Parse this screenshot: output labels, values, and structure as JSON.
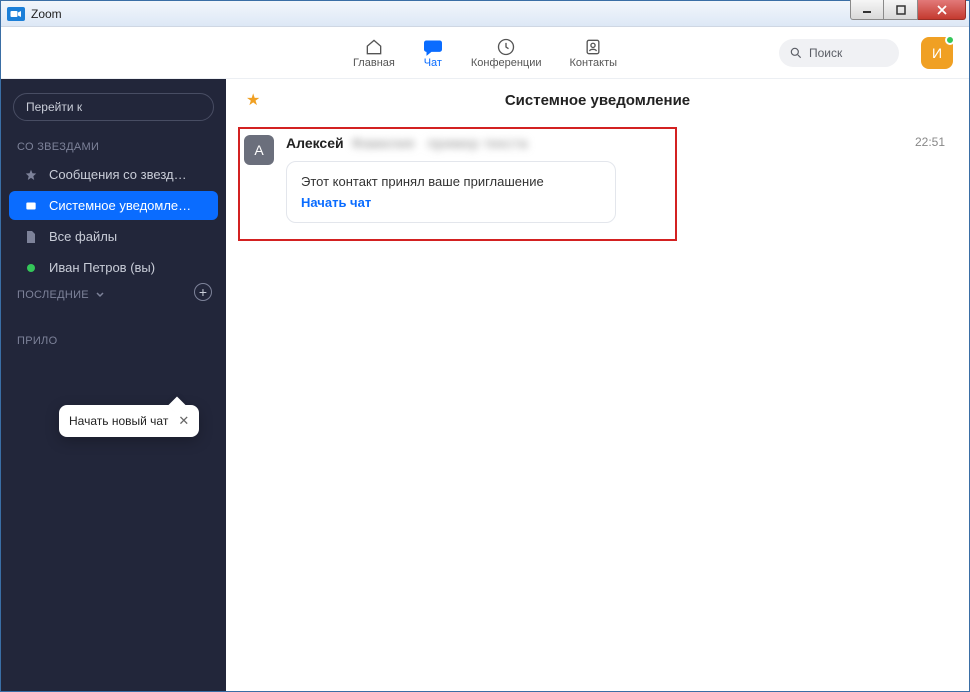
{
  "window": {
    "title": "Zoom"
  },
  "nav": {
    "home": "Главная",
    "chat": "Чат",
    "meetings": "Конференции",
    "contacts": "Контакты"
  },
  "search": {
    "placeholder": "Поиск"
  },
  "user_avatar": {
    "initial": "И"
  },
  "sidebar": {
    "jump_to": "Перейти к",
    "section_starred": "СО ЗВЕЗДАМИ",
    "items": [
      {
        "label": "Сообщения со звезд…"
      },
      {
        "label": "Системное уведомле…"
      },
      {
        "label": "Все файлы"
      },
      {
        "label": "Иван Петров (вы)"
      }
    ],
    "section_recent": "ПОСЛЕДНИЕ",
    "section_apps": "ПРИЛО"
  },
  "tooltip": {
    "text": "Начать новый чат"
  },
  "chat": {
    "title": "Системное уведомление",
    "message": {
      "avatar_initial": "А",
      "sender": "Алексей",
      "time": "22:51",
      "invite_text": "Этот контакт принял ваше приглашение",
      "start_chat": "Начать чат"
    }
  }
}
